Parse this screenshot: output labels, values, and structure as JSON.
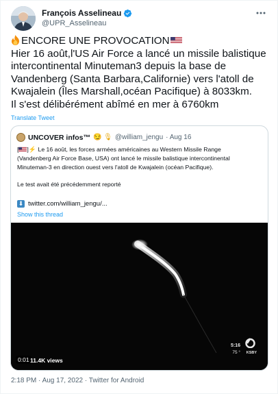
{
  "tweet": {
    "author_name": "François Asselineau",
    "author_handle": "@UPR_Asselineau",
    "text_lines": [
      "ENCORE UNE PROVOCATION",
      "Hier 16 août,l'US Air Force a lancé un missile balistique",
      "intercontinental Minuteman3 depuis la base de",
      "Vandenberg (Santa Barbara,Californie) vers l'atoll de",
      "Kwajalein (Îles Marshall,océan Pacifique) à 8033km.",
      "Il s'est délibérément abîmé en mer à 6760km"
    ],
    "translate_label": "Translate Tweet",
    "timestamp": "2:18 PM · Aug 17, 2022 · Twitter for Android"
  },
  "quote": {
    "author_name": "UNCOVER infos™",
    "author_handle": "@william_jengu",
    "date": "· Aug 16",
    "text_lines": [
      "Le 16 août, les forces armées américaines au Western Missile Range",
      "(Vandenberg Air Force Base, USA) ont lancé le missile balistique intercontinental",
      "Minuteman-3 en direction ouest vers l'atoll de Kwajalein (océan Pacifique).",
      "",
      "Le test avait été précédemment reporté"
    ],
    "link_text": "twitter.com/william_jengu/...",
    "show_thread": "Show this thread"
  },
  "video": {
    "duration": "0:01",
    "views": "11.4K views",
    "overlay_time": "5:16",
    "overlay_temp": "75 °",
    "overlay_channel": "KSBY"
  },
  "icons": {
    "verified": "verified-badge-icon",
    "more": "more-options-icon",
    "fire": "fire-emoji-icon",
    "flag": "us-flag-emoji-icon",
    "link_arrow": "down-arrow-emoji-icon",
    "channel_logo": "channel-6-logo-icon"
  },
  "colors": {
    "accent": "#1d9bf0",
    "text_primary": "#0f1419",
    "text_secondary": "#536471",
    "border": "#cfd9de"
  }
}
